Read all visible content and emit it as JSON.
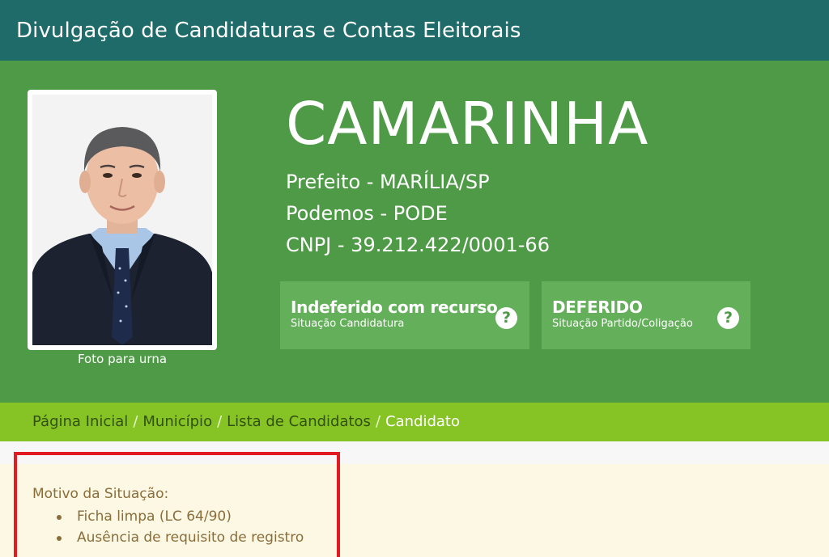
{
  "header": {
    "title": "Divulgação de Candidaturas e Contas Eleitorais"
  },
  "candidate": {
    "photo_caption": "Foto para urna",
    "name": "CAMARINHA",
    "office_line": "Prefeito - MARÍLIA/SP",
    "party_line": "Podemos - PODE",
    "cnpj_line": "CNPJ - 39.212.422/0001-66"
  },
  "status": [
    {
      "main": "Indeferido com recurso",
      "sub": "Situação Candidatura",
      "icon": "help-icon"
    },
    {
      "main": "DEFERIDO",
      "sub": "Situação Partido/Coligação",
      "icon": "help-icon"
    }
  ],
  "breadcrumb": {
    "items": [
      "Página Inicial",
      "Município",
      "Lista de Candidatos"
    ],
    "separator": "/",
    "current": "Candidato"
  },
  "reason": {
    "title": "Motivo da Situação:",
    "items": [
      "Ficha limpa (LC 64/90)",
      "Ausência de requisito de registro"
    ]
  },
  "colors": {
    "topbar": "#1e6b6a",
    "hero": "#4f9a47",
    "status_box": "#64b05a",
    "breadcrumb_bar": "#86c425",
    "alert_bg": "#fcf8e3",
    "highlight": "#e21b23"
  }
}
